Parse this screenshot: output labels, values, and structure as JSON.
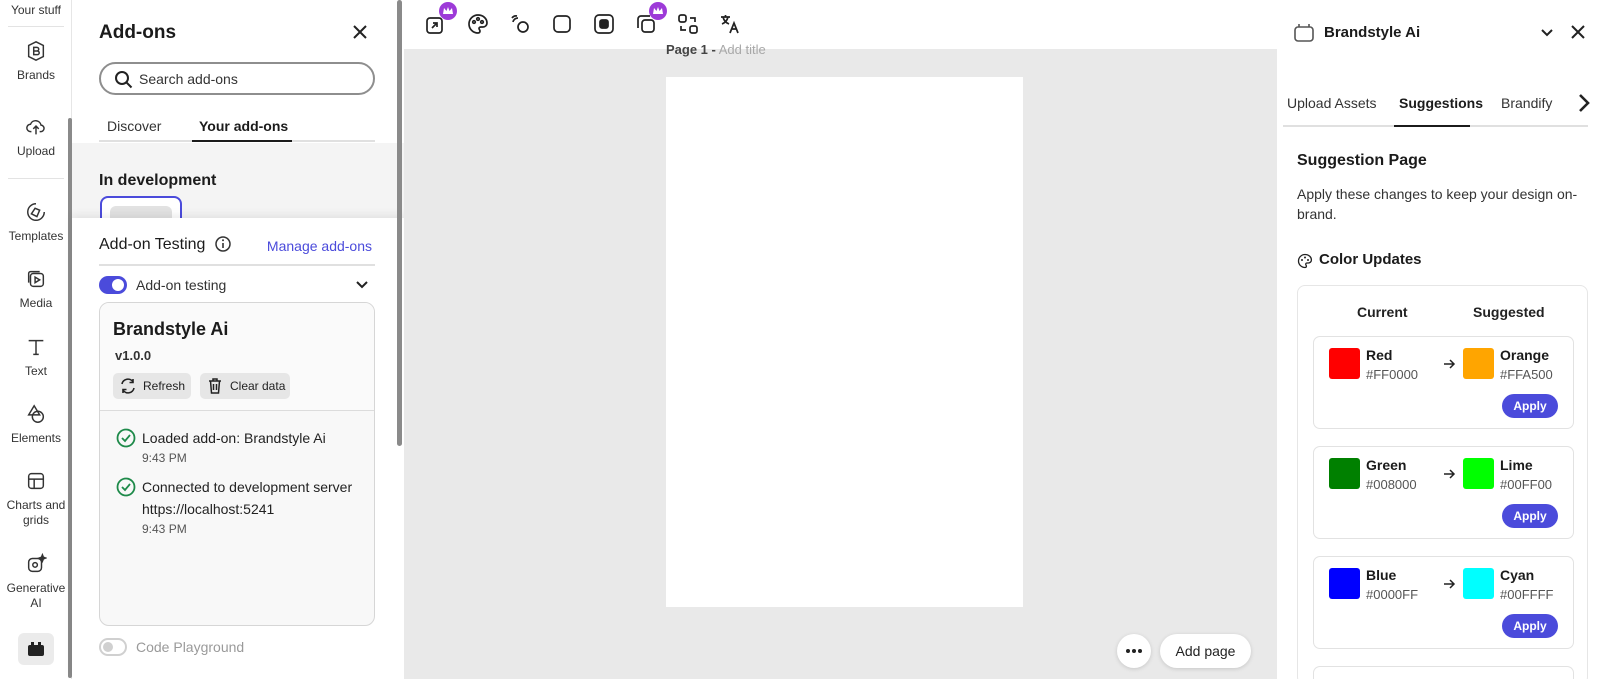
{
  "rail": {
    "top_label": "Your stuff",
    "items": [
      {
        "label": "Brands"
      },
      {
        "label": "Upload"
      },
      {
        "label": "Templates"
      },
      {
        "label": "Media"
      },
      {
        "label": "Text"
      },
      {
        "label": "Elements"
      },
      {
        "label": "Charts and grids"
      },
      {
        "label": "Generative AI"
      }
    ]
  },
  "addons": {
    "title": "Add-ons",
    "search_placeholder": "Search add-ons",
    "tabs": [
      {
        "label": "Discover"
      },
      {
        "label": "Your add-ons"
      }
    ],
    "active_tab": "Your add-ons",
    "in_development": "In development",
    "testing": {
      "title": "Add-on Testing",
      "manage_link": "Manage add-ons",
      "toggle_label": "Add-on testing",
      "toggle_on": true,
      "card": {
        "name": "Brandstyle Ai",
        "version": "v1.0.0",
        "refresh_label": "Refresh",
        "clear_label": "Clear data",
        "logs": [
          {
            "message": "Loaded add-on: Brandstyle Ai",
            "time": "9:43 PM"
          },
          {
            "message": "Connected to development server",
            "message2": "https://localhost:5241",
            "time": "9:43 PM"
          }
        ]
      },
      "playground_label": "Code Playground",
      "playground_on": false
    }
  },
  "canvas": {
    "page_label": "Page 1 -",
    "page_title_placeholder": "Add title",
    "add_page_label": "Add page"
  },
  "right_panel": {
    "title": "Brandstyle Ai",
    "tabs": [
      {
        "label": "Upload Assets"
      },
      {
        "label": "Suggestions"
      },
      {
        "label": "Brandify"
      }
    ],
    "active_tab": "Suggestions",
    "suggestion_title": "Suggestion Page",
    "suggestion_desc": "Apply these changes to keep your design on-brand.",
    "color_updates_title": "Color Updates",
    "col_current": "Current",
    "col_suggested": "Suggested",
    "apply_label": "Apply",
    "updates": [
      {
        "current_name": "Red",
        "current_hex": "#FF0000",
        "suggested_name": "Orange",
        "suggested_hex": "#FFA500"
      },
      {
        "current_name": "Green",
        "current_hex": "#008000",
        "suggested_name": "Lime",
        "suggested_hex": "#00FF00"
      },
      {
        "current_name": "Blue",
        "current_hex": "#0000FF",
        "suggested_name": "Cyan",
        "suggested_hex": "#00FFFF"
      }
    ]
  },
  "colors": {
    "accent": "#4b4bdb",
    "premium": "#9d3ad8",
    "canvas_bg": "#e9e9e9"
  },
  "toolbar": {
    "icons": [
      "resize-icon",
      "color-palette-icon",
      "animate-icon",
      "shape-icon",
      "mask-icon",
      "layers-icon",
      "replace-icon",
      "translate-icon"
    ]
  }
}
